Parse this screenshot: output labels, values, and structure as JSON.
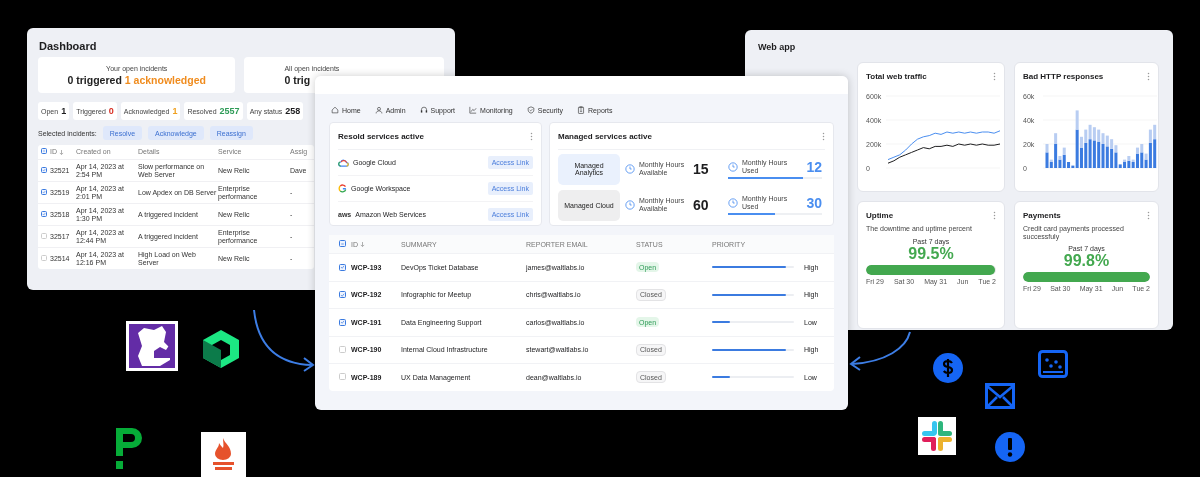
{
  "dashboard": {
    "title": "Dashboard",
    "summary_cards": [
      {
        "label": "Your open incidents",
        "parts": [
          {
            "text": "0 triggered",
            "color": "#222222"
          },
          {
            "text": "1 acknowledged",
            "color": "#f08c1e"
          }
        ]
      },
      {
        "label": "All open incidents",
        "parts": [
          {
            "text": "0 trig",
            "color": "#222222"
          }
        ]
      }
    ],
    "stats": [
      {
        "label": "Open",
        "value": "1",
        "color": "#1d1d1f"
      },
      {
        "label": "Triggered",
        "value": "0",
        "color": "#d93025"
      },
      {
        "label": "Acknowledged",
        "value": "1",
        "color": "#f0a01e"
      },
      {
        "label": "Resolved",
        "value": "2557",
        "color": "#2e9b57"
      },
      {
        "label": "Any status",
        "value": "258",
        "color": "#1d1d1f"
      }
    ],
    "actions_label": "Selected incidents:",
    "actions": [
      "Resolve",
      "Acknowledge",
      "Reassign"
    ],
    "table": {
      "header_indeterminate": true,
      "columns": [
        "ID",
        "Created on",
        "Details",
        "Service",
        "Assig"
      ],
      "rows": [
        {
          "checked": true,
          "cells": [
            "32521",
            "Apr 14, 2023 at 2:54 PM",
            "Slow performance on Web Server",
            "New Relic",
            "Dave"
          ]
        },
        {
          "checked": true,
          "cells": [
            "32519",
            "Apr 14, 2023 at 2:01 PM",
            "Low Apdex on DB Server",
            "Enterprise performance",
            "-"
          ]
        },
        {
          "checked": true,
          "cells": [
            "32518",
            "Apr 14, 2023 at 1:30 PM",
            "A triggered incident",
            "New Relic",
            "-"
          ]
        },
        {
          "checked": false,
          "cells": [
            "32517",
            "Apr 14, 2023 at 12:44 PM",
            "A triggered incident",
            "Enterprise performance",
            "-"
          ]
        },
        {
          "checked": false,
          "cells": [
            "32514",
            "Apr 14, 2023 at 12:16 PM",
            "High Load on Web Server",
            "New Relic",
            "-"
          ]
        }
      ]
    }
  },
  "portal": {
    "nav": [
      {
        "label": "Home"
      },
      {
        "label": "Admin"
      },
      {
        "label": "Support"
      },
      {
        "label": "Monitoring"
      },
      {
        "label": "Security"
      },
      {
        "label": "Reports"
      }
    ],
    "resold": {
      "title": "Resold services active",
      "items": [
        {
          "kind": "cloud",
          "name": "Google Cloud",
          "link": "Access Link"
        },
        {
          "kind": "letter",
          "name": "Google Workspace",
          "link": "Access Link"
        },
        {
          "kind": "wordmark",
          "logo": "aws",
          "name": "Amazon Web Services",
          "link": "Access Link"
        }
      ]
    },
    "managed": {
      "title": "Managed services active",
      "items": [
        {
          "name": "Managed Analytics",
          "selected": true,
          "available_label": "Monthly Hours Available",
          "available": "15",
          "used_label": "Monthly Hours Used",
          "used": "12",
          "level": 0.8
        },
        {
          "name": "Managed Cloud",
          "selected": false,
          "available_label": "Monthly Hours Available",
          "available": "60",
          "used_label": "Monthly Hours Used",
          "used": "30",
          "level": 0.5
        }
      ]
    },
    "table": {
      "header_indeterminate": true,
      "columns": [
        "ID",
        "SUMMARY",
        "REPORTER EMAIL",
        "STATUS",
        "PRIORITY"
      ],
      "rows": [
        {
          "checked": true,
          "id": "WCP-193",
          "summary": "DevOps Ticket Database",
          "email": "james@waltlabs.io",
          "status": {
            "text": "Open",
            "kind": "open"
          },
          "level": 0.9,
          "priority": "High"
        },
        {
          "checked": true,
          "id": "WCP-192",
          "summary": "Infographic for Meetup",
          "email": "chris@waltlabs.io",
          "status": {
            "text": "Closed",
            "kind": "closed"
          },
          "level": 0.9,
          "priority": "High"
        },
        {
          "checked": true,
          "id": "WCP-191",
          "summary": "Data Engineering Support",
          "email": "carlos@waltlabs.io",
          "status": {
            "text": "Open",
            "kind": "open"
          },
          "level": 0.22,
          "priority": "Low"
        },
        {
          "checked": false,
          "id": "WCP-190",
          "summary": "Internal Cloud Infrastructure",
          "email": "stewart@waltlabs.io",
          "status": {
            "text": "Closed",
            "kind": "closed"
          },
          "level": 0.9,
          "priority": "High"
        },
        {
          "checked": false,
          "id": "WCP-189",
          "summary": "UX Data Management",
          "email": "dean@waltlabs.io",
          "status": {
            "text": "Closed",
            "kind": "closed"
          },
          "level": 0.22,
          "priority": "Low"
        }
      ]
    }
  },
  "webapp": {
    "title": "Web app",
    "traffic": {
      "title": "Total web traffic",
      "chart_data": {
        "type": "line",
        "ylim": [
          0,
          600
        ],
        "yticks": [
          {
            "value": 0,
            "label": "0"
          },
          {
            "value": 200,
            "label": "200k"
          },
          {
            "value": 400,
            "label": "400k"
          },
          {
            "value": 600,
            "label": "600k"
          }
        ],
        "series": [
          {
            "color": "#4a8ef0",
            "values": [
              70,
              90,
              110,
              150,
              200,
              240,
              260,
              270,
              290,
              280,
              300,
              290,
              300,
              290,
              300,
              290,
              300,
              300,
              290,
              310
            ]
          },
          {
            "color": "#1d1d1f",
            "values": [
              40,
              60,
              90,
              110,
              130,
              150,
              170,
              160,
              180,
              180,
              190,
              180,
              200,
              190,
              200,
              190,
              200,
              190,
              190,
              200
            ]
          }
        ]
      }
    },
    "http": {
      "title": "Bad HTTP responses",
      "chart_data": {
        "type": "bar",
        "stacked": true,
        "ylim": [
          0,
          60
        ],
        "yticks": [
          {
            "value": 0,
            "label": "0"
          },
          {
            "value": 20,
            "label": "20k"
          },
          {
            "value": 40,
            "label": "40k"
          },
          {
            "value": 60,
            "label": "60k"
          }
        ],
        "series": [
          {
            "color": "#3b7be0",
            "values": [
              13,
              5,
              20,
              7,
              11,
              5,
              2,
              32,
              17,
              21,
              24,
              23,
              22,
              20,
              18,
              16,
              13,
              3,
              5,
              6,
              5,
              12,
              13,
              7,
              21,
              24
            ]
          },
          {
            "color": "#b8cdf2",
            "values": [
              7,
              2,
              9,
              3,
              6,
              null,
              0,
              16,
              9,
              11,
              12,
              11,
              10,
              9,
              9,
              8,
              6,
              null,
              2,
              4,
              2,
              5,
              7,
              5,
              11,
              12
            ]
          }
        ]
      }
    },
    "uptime": {
      "title": "Uptime",
      "subtitle": "The downtime and uptime percent",
      "period": "Past 7 days",
      "value": "99.5%",
      "level": 0.995,
      "ticks": [
        "Fri 29",
        "Sat 30",
        "May 31",
        "Jun",
        "Tue 2"
      ]
    },
    "payments": {
      "title": "Payments",
      "subtitle": "Credit card payments processed successfuly",
      "period": "Past 7 days",
      "value": "99.8%",
      "level": 0.998,
      "ticks": [
        "Fri 29",
        "Sat 30",
        "May 31",
        "Jun",
        "Tue 2"
      ]
    }
  }
}
